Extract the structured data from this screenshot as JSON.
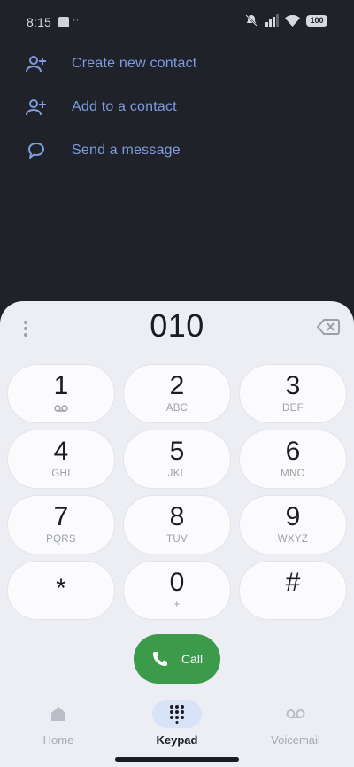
{
  "status": {
    "time": "8:15",
    "notif_dots": "··",
    "battery": "100"
  },
  "actions": [
    {
      "label": "Create new contact",
      "icon": "add-person-icon"
    },
    {
      "label": "Add to a contact",
      "icon": "add-person-icon"
    },
    {
      "label": "Send a message",
      "icon": "message-icon"
    }
  ],
  "dialer": {
    "number": "010"
  },
  "keys": [
    {
      "digit": "1",
      "letters": ""
    },
    {
      "digit": "2",
      "letters": "ABC"
    },
    {
      "digit": "3",
      "letters": "DEF"
    },
    {
      "digit": "4",
      "letters": "GHI"
    },
    {
      "digit": "5",
      "letters": "JKL"
    },
    {
      "digit": "6",
      "letters": "MNO"
    },
    {
      "digit": "7",
      "letters": "PQRS"
    },
    {
      "digit": "8",
      "letters": "TUV"
    },
    {
      "digit": "9",
      "letters": "WXYZ"
    },
    {
      "digit": "*",
      "letters": ""
    },
    {
      "digit": "0",
      "letters": "+"
    },
    {
      "digit": "#",
      "letters": ""
    }
  ],
  "call_button": {
    "label": "Call"
  },
  "nav": {
    "home": "Home",
    "keypad": "Keypad",
    "voicemail": "Voicemail"
  },
  "colors": {
    "accent_blue": "#7e9be0",
    "call_green": "#3b9b4a",
    "sheet_bg": "#eceef4",
    "dark_bg": "#1f2228"
  }
}
